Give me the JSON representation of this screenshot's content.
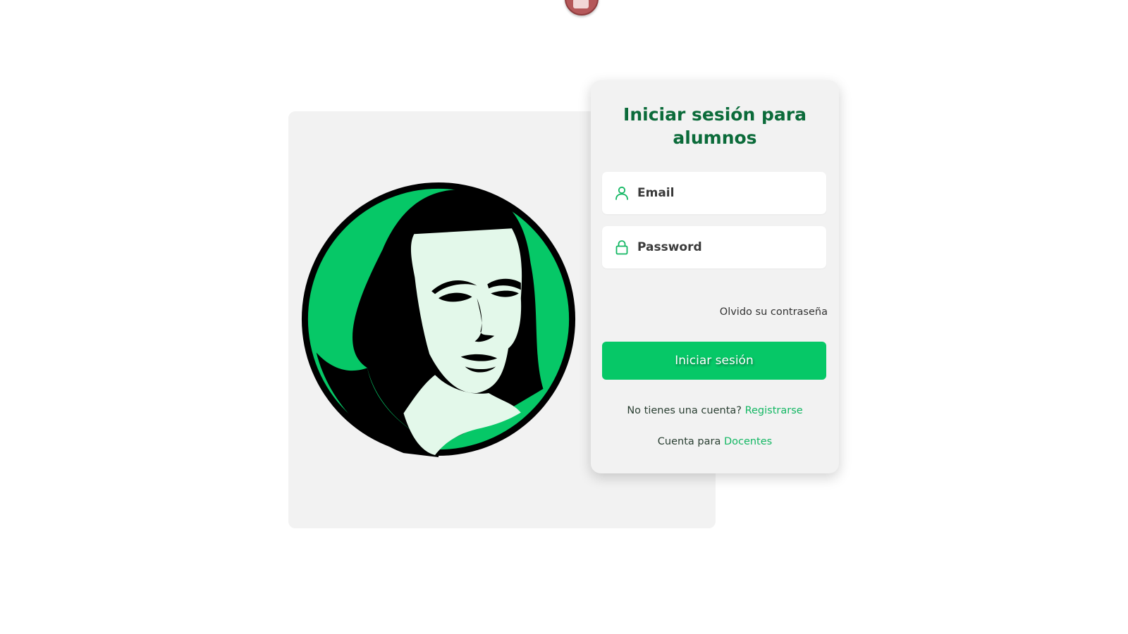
{
  "login_card": {
    "title": "Iniciar sesión para alumnos",
    "email_field": {
      "placeholder": "Email",
      "value": "",
      "icon": "user-icon"
    },
    "password_field": {
      "placeholder": "Password",
      "value": "",
      "icon": "lock-icon"
    },
    "forgot_password_link": "Olvido su contraseña",
    "submit_button": "Iniciar sesión",
    "register_prompt": "No tienes una cuenta?",
    "register_link": "Registrarse",
    "teacher_prompt": "Cuenta para",
    "teacher_link": "Docentes"
  },
  "logo": {
    "icon": "sor-juana-portrait-logo"
  },
  "colors": {
    "primary_green": "#06c867",
    "title_green": "#0b6b3a",
    "link_green": "#13b763",
    "panel_bg": "#f2f2f2",
    "portrait_light": "#e3f8ea"
  }
}
